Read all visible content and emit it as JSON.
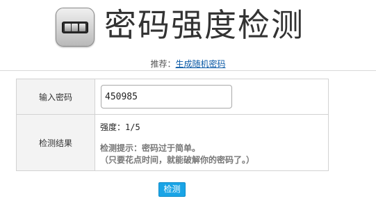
{
  "header": {
    "title": "密码强度检测"
  },
  "recommend": {
    "prefix": "推荐：",
    "link_label": "生成随机密码"
  },
  "form": {
    "password_label": "输入密码",
    "password_value": "450985",
    "result_label": "检测结果",
    "strength_prefix": "强度：",
    "strength_score": "1/5",
    "hint_line1": "检测提示：密码过于简单。",
    "hint_line2": "（只要花点时间，就能破解你的密码了。）"
  },
  "actions": {
    "check_label": "检测"
  },
  "icons": {
    "logo": "password-lock-icon"
  },
  "colors": {
    "button_bg": "#1aa4e6",
    "link": "#0b5aa6"
  }
}
